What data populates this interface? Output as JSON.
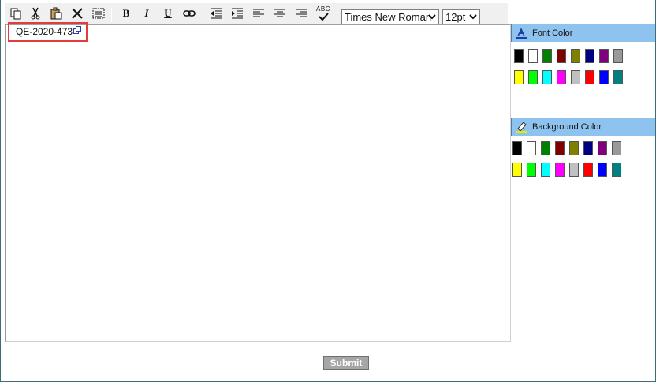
{
  "toolbar": {
    "font_family": "Times New Roman",
    "font_size": "12pt",
    "bold_label": "B",
    "italic_label": "I",
    "underline_label": "U",
    "spell_label": "ABC"
  },
  "editor": {
    "content": "QE-2020-473"
  },
  "panels": {
    "font_color": {
      "title": "Font Color",
      "swatches_row1": [
        "#000000",
        "#ffffff",
        "#008000",
        "#800000",
        "#808000",
        "#000080",
        "#800080",
        "#999999"
      ],
      "swatches_row2": [
        "#ffff00",
        "#00ff00",
        "#00ffff",
        "#ff00ff",
        "#c0c0c0",
        "#ff0000",
        "#0000ff",
        "#008080"
      ]
    },
    "background_color": {
      "title": "Background Color",
      "swatches_row1": [
        "#000000",
        "#ffffff",
        "#008000",
        "#800000",
        "#808000",
        "#000080",
        "#800080",
        "#999999"
      ],
      "swatches_row2": [
        "#ffff00",
        "#00ff00",
        "#00ffff",
        "#ff00ff",
        "#c0c0c0",
        "#ff0000",
        "#0000ff",
        "#008080"
      ]
    }
  },
  "submit_label": "Submit",
  "colors": {
    "highlight_border": "#e33c3c",
    "panel_header_bg": "#8fc3ef"
  }
}
